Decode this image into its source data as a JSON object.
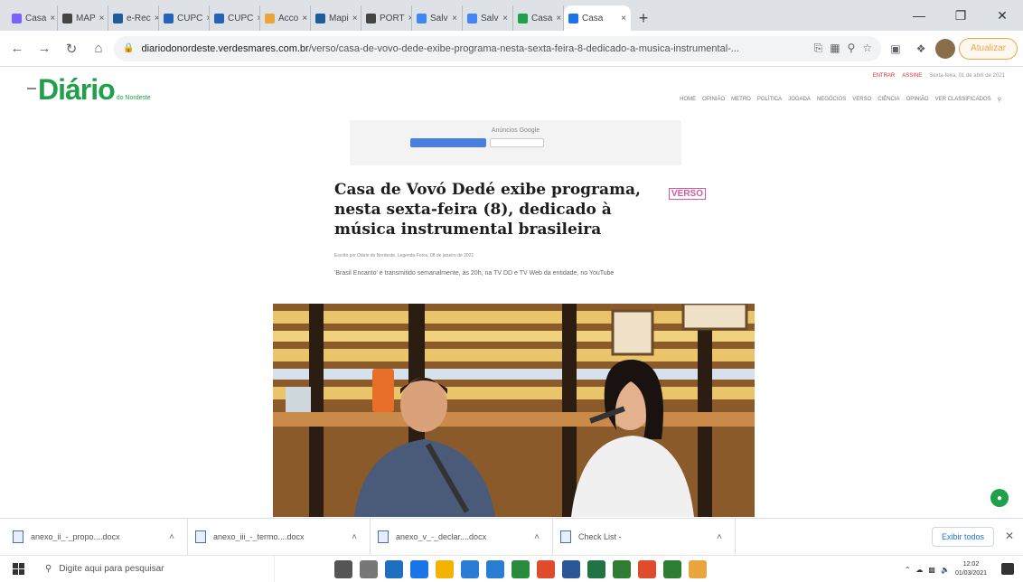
{
  "browser": {
    "tabs": [
      {
        "label": "Casa",
        "color": "#7b61ff"
      },
      {
        "label": "MAP",
        "color": "#444444"
      },
      {
        "label": "e-Rec",
        "color": "#1b5e9a"
      },
      {
        "label": "CUPC",
        "color": "#2563b6"
      },
      {
        "label": "CUPC",
        "color": "#2563b6"
      },
      {
        "label": "Acco",
        "color": "#e8a63c"
      },
      {
        "label": "Mapi",
        "color": "#1b5e9a"
      },
      {
        "label": "PORT",
        "color": "#444444"
      },
      {
        "label": "Salv",
        "color": "#4285f4"
      },
      {
        "label": "Salv",
        "color": "#4285f4"
      },
      {
        "label": "Casa",
        "color": "#21a04b"
      },
      {
        "label": "Casa",
        "color": "#1a73e8"
      }
    ],
    "active_tab_index": 11,
    "new_tab": "+",
    "url_host": "diariodonordeste.verdesmares.com.br",
    "url_path": "/verso/casa-de-vovo-dede-exibe-programa-nesta-sexta-feira-8-dedicado-a-musica-instrumental-...",
    "update_label": "Atualizar"
  },
  "site": {
    "logo": "Diário",
    "logo_sub": "do Nordeste",
    "top_links": [
      "ENTRAR",
      "ASSINE"
    ],
    "date": "Sexta-feira, 01 de abril de 2021",
    "nav": [
      "HOME",
      "OPINIÃO",
      "METRO",
      "POLÍTICA",
      "JOGADA",
      "NEGÓCIOS",
      "VERSO",
      "CIÊNCIA",
      "OPINIÃO",
      "VER CLASSIFICADOS"
    ]
  },
  "ad": {
    "label": "Anúncios Google"
  },
  "article": {
    "headline_lines": [
      "Casa de Vovó Dedé exibe programa,",
      "nesta sexta-feira (8), dedicado à",
      "música instrumental brasileira"
    ],
    "badge": "VERSO",
    "byline": "Escrito por Diário do Nordeste, Legenda Fotos, 08 de janeiro de 2021",
    "subhead": "'Brasil Encanto' é transmitido semanalmente, às 20h, na TV DD e TV Web da entidade, no YouTube"
  },
  "downloads": {
    "items": [
      {
        "name": "anexo_ii_-_propo....docx"
      },
      {
        "name": "anexo_iii_-_termo....docx"
      },
      {
        "name": "anexo_v_-_declar....docx"
      },
      {
        "name": "Check List -"
      }
    ],
    "show_all": "Exibir todos"
  },
  "taskbar": {
    "search_placeholder": "Digite aqui para pesquisar",
    "time": "12:02",
    "date": "01/03/2021",
    "apps": [
      "#555555",
      "#777777",
      "#1e6fbf",
      "#1a73e8",
      "#f2b400",
      "#2b7cd3",
      "#2b7cd3",
      "#2a8a3e",
      "#e04a2d",
      "#2b5797",
      "#217346",
      "#2e7d32",
      "#e04a2d",
      "#2e7d32",
      "#e8a63c"
    ]
  }
}
